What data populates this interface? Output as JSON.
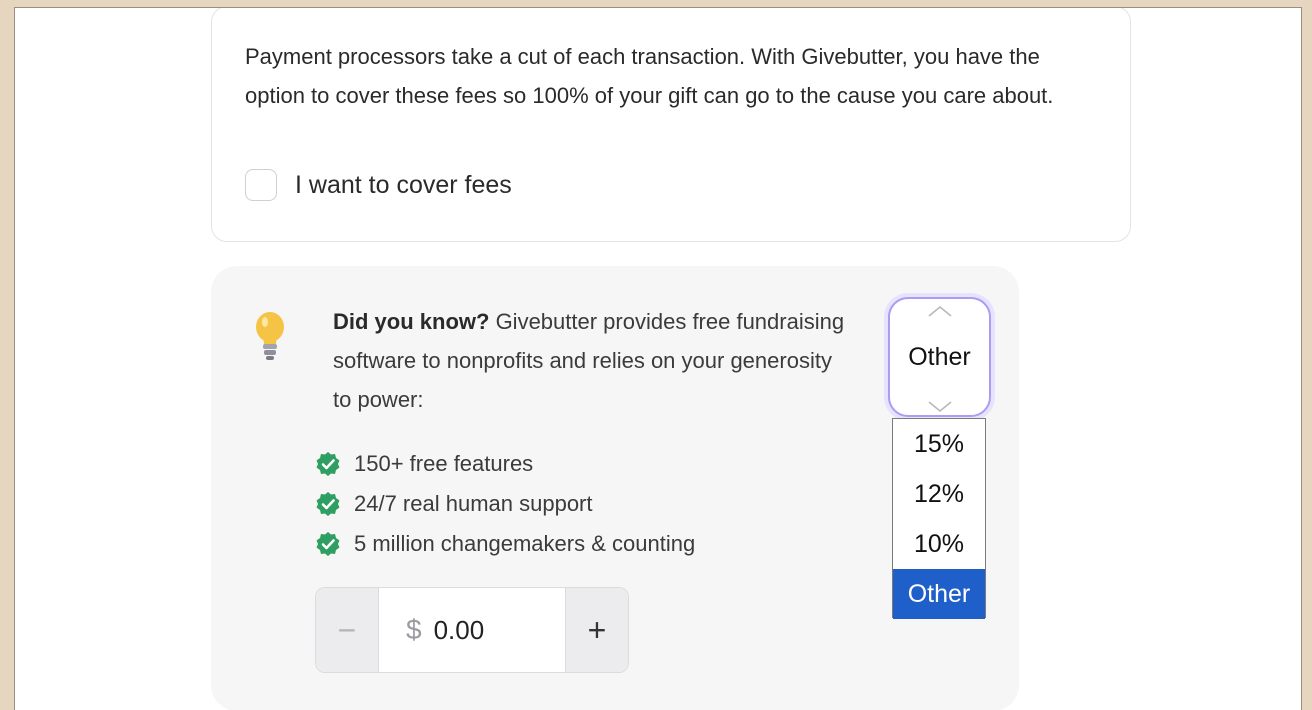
{
  "fees_card": {
    "description": "Payment processors take a cut of each transaction. With Givebutter, you have the option to cover these fees so 100% of your gift can go to the cause you care about.",
    "checkbox_label": "I want to cover fees",
    "checked": false
  },
  "tip_card": {
    "headline": "Did you know?",
    "body": " Givebutter provides free fundraising software to nonprofits and relies on your generosity to power:",
    "features": [
      "150+ free features",
      "24/7 real human support",
      "5 million changemakers & counting"
    ],
    "stepper": {
      "minus_label": "−",
      "plus_label": "+",
      "currency": "$",
      "value": "0.00"
    },
    "tip_select": {
      "selected": "Other",
      "options": [
        "15%",
        "12%",
        "10%",
        "Other"
      ]
    }
  },
  "colors": {
    "accent_check": "#2f9e62",
    "focus_ring": "#a89ef2",
    "option_highlight": "#1f5fc9",
    "bulb": "#f6c445"
  }
}
